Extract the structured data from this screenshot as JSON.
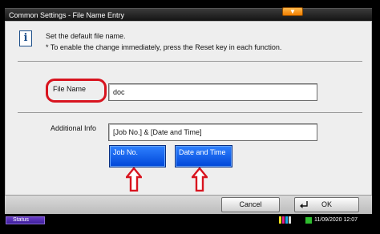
{
  "window": {
    "title": "Common Settings - File Name Entry"
  },
  "info": {
    "icon": "info-icon",
    "line1": "Set the default file name.",
    "line2": "* To enable the change immediately, press the Reset key in each function."
  },
  "file_name": {
    "label": "File Name",
    "value": "doc",
    "highlight_color": "#d8141f"
  },
  "additional_info": {
    "label": "Additional Info",
    "value": "[Job No.] & [Date and Time]",
    "buttons": {
      "job_no": "Job No.",
      "date_time": "Date and Time"
    },
    "arrow_color": "#d8141f"
  },
  "actions": {
    "cancel": "Cancel",
    "ok": "OK",
    "ok_icon": "enter-icon"
  },
  "status_bar": {
    "status_label": "Status",
    "datetime": "11/09/2020  12:07"
  },
  "colors": {
    "accent_blue": "#0046d8",
    "title_tab": "#f07d00",
    "status_purple": "#3d1f9a"
  }
}
